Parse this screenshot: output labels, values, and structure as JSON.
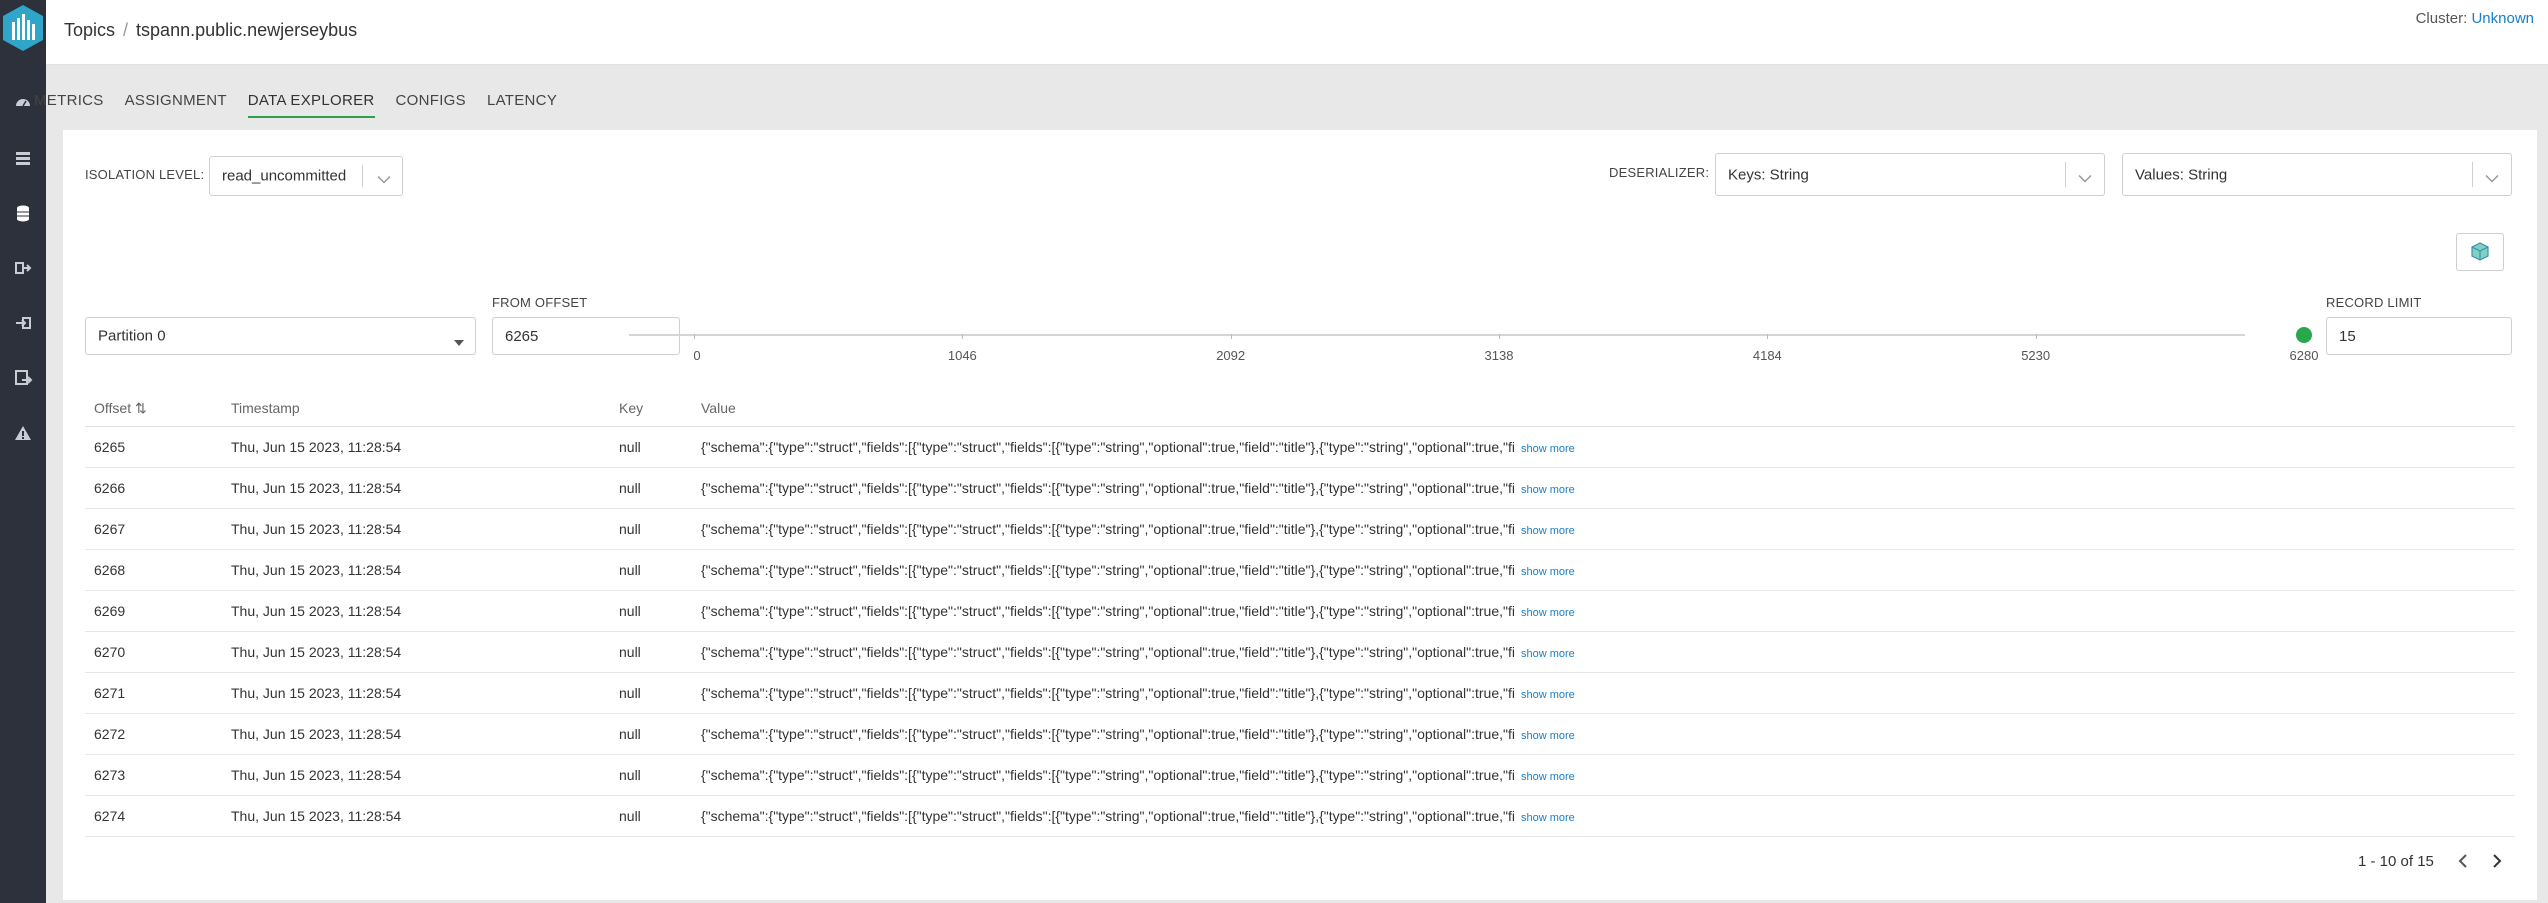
{
  "breadcrumb": {
    "root": "Topics",
    "separator": "/",
    "current": "tspann.public.newjerseybus"
  },
  "cluster": {
    "label": "Cluster:",
    "value": "Unknown"
  },
  "sidebar": {
    "items": [
      {
        "icon": "dashboard-icon"
      },
      {
        "icon": "topics-list-icon"
      },
      {
        "icon": "database-icon"
      },
      {
        "icon": "producer-icon"
      },
      {
        "icon": "consumer-icon"
      },
      {
        "icon": "connectors-icon"
      },
      {
        "icon": "warning-icon"
      }
    ]
  },
  "tabs": [
    {
      "label": "METRICS",
      "active": false
    },
    {
      "label": "ASSIGNMENT",
      "active": false
    },
    {
      "label": "DATA EXPLORER",
      "active": true
    },
    {
      "label": "CONFIGS",
      "active": false
    },
    {
      "label": "LATENCY",
      "active": false
    }
  ],
  "isolation": {
    "label": "ISOLATION LEVEL:",
    "value": "read_uncommitted"
  },
  "deserializer": {
    "label": "DESERIALIZER:",
    "keys": "Keys: String",
    "values": "Values: String"
  },
  "partition": {
    "value": "Partition 0"
  },
  "offset": {
    "label": "FROM OFFSET",
    "value": "6265"
  },
  "slider": {
    "ticks": [
      "0",
      "1046",
      "2092",
      "3138",
      "4184",
      "5230",
      "6280"
    ],
    "value_fraction": 1.0
  },
  "record_limit": {
    "label": "RECORD LIMIT",
    "value": "15"
  },
  "table": {
    "headers": {
      "offset": "Offset",
      "sort_icon": "⇅",
      "timestamp": "Timestamp",
      "key": "Key",
      "value": "Value"
    },
    "show_more": "show more",
    "rows": [
      {
        "offset": "6265",
        "timestamp": "Thu, Jun 15 2023, 11:28:54",
        "key": "null",
        "value": "{\"schema\":{\"type\":\"struct\",\"fields\":[{\"type\":\"struct\",\"fields\":[{\"type\":\"string\",\"optional\":true,\"field\":\"title\"},{\"type\":\"string\",\"optional\":true,\"fi"
      },
      {
        "offset": "6266",
        "timestamp": "Thu, Jun 15 2023, 11:28:54",
        "key": "null",
        "value": "{\"schema\":{\"type\":\"struct\",\"fields\":[{\"type\":\"struct\",\"fields\":[{\"type\":\"string\",\"optional\":true,\"field\":\"title\"},{\"type\":\"string\",\"optional\":true,\"fi"
      },
      {
        "offset": "6267",
        "timestamp": "Thu, Jun 15 2023, 11:28:54",
        "key": "null",
        "value": "{\"schema\":{\"type\":\"struct\",\"fields\":[{\"type\":\"struct\",\"fields\":[{\"type\":\"string\",\"optional\":true,\"field\":\"title\"},{\"type\":\"string\",\"optional\":true,\"fi"
      },
      {
        "offset": "6268",
        "timestamp": "Thu, Jun 15 2023, 11:28:54",
        "key": "null",
        "value": "{\"schema\":{\"type\":\"struct\",\"fields\":[{\"type\":\"struct\",\"fields\":[{\"type\":\"string\",\"optional\":true,\"field\":\"title\"},{\"type\":\"string\",\"optional\":true,\"fi"
      },
      {
        "offset": "6269",
        "timestamp": "Thu, Jun 15 2023, 11:28:54",
        "key": "null",
        "value": "{\"schema\":{\"type\":\"struct\",\"fields\":[{\"type\":\"struct\",\"fields\":[{\"type\":\"string\",\"optional\":true,\"field\":\"title\"},{\"type\":\"string\",\"optional\":true,\"fi"
      },
      {
        "offset": "6270",
        "timestamp": "Thu, Jun 15 2023, 11:28:54",
        "key": "null",
        "value": "{\"schema\":{\"type\":\"struct\",\"fields\":[{\"type\":\"struct\",\"fields\":[{\"type\":\"string\",\"optional\":true,\"field\":\"title\"},{\"type\":\"string\",\"optional\":true,\"fi"
      },
      {
        "offset": "6271",
        "timestamp": "Thu, Jun 15 2023, 11:28:54",
        "key": "null",
        "value": "{\"schema\":{\"type\":\"struct\",\"fields\":[{\"type\":\"struct\",\"fields\":[{\"type\":\"string\",\"optional\":true,\"field\":\"title\"},{\"type\":\"string\",\"optional\":true,\"fi"
      },
      {
        "offset": "6272",
        "timestamp": "Thu, Jun 15 2023, 11:28:54",
        "key": "null",
        "value": "{\"schema\":{\"type\":\"struct\",\"fields\":[{\"type\":\"struct\",\"fields\":[{\"type\":\"string\",\"optional\":true,\"field\":\"title\"},{\"type\":\"string\",\"optional\":true,\"fi"
      },
      {
        "offset": "6273",
        "timestamp": "Thu, Jun 15 2023, 11:28:54",
        "key": "null",
        "value": "{\"schema\":{\"type\":\"struct\",\"fields\":[{\"type\":\"struct\",\"fields\":[{\"type\":\"string\",\"optional\":true,\"field\":\"title\"},{\"type\":\"string\",\"optional\":true,\"fi"
      },
      {
        "offset": "6274",
        "timestamp": "Thu, Jun 15 2023, 11:28:54",
        "key": "null",
        "value": "{\"schema\":{\"type\":\"struct\",\"fields\":[{\"type\":\"struct\",\"fields\":[{\"type\":\"string\",\"optional\":true,\"field\":\"title\"},{\"type\":\"string\",\"optional\":true,\"fi"
      }
    ]
  },
  "pagination": {
    "text": "1 - 10 of 15"
  },
  "colors": {
    "accent_green": "#27a84a",
    "link_blue": "#1a7ec8",
    "sidebar_bg": "#2c313b"
  }
}
